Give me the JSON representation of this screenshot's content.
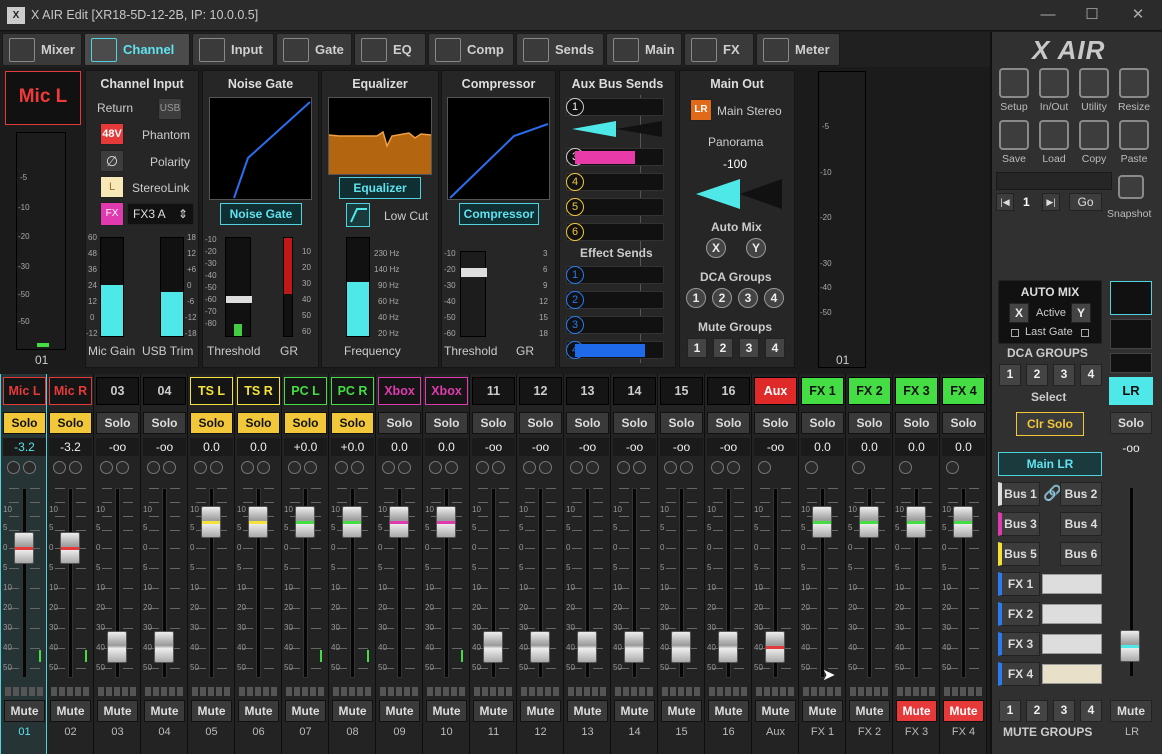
{
  "window": {
    "title": "X AIR Edit [XR18-5D-12-2B, IP: 10.0.0.5]",
    "app_icon": "X",
    "min": "—",
    "max": "☐",
    "close": "✕"
  },
  "tabs": [
    {
      "label": "Mixer"
    },
    {
      "label": "Channel"
    },
    {
      "label": "Input"
    },
    {
      "label": "Gate"
    },
    {
      "label": "EQ"
    },
    {
      "label": "Comp"
    },
    {
      "label": "Sends"
    },
    {
      "label": "Main"
    },
    {
      "label": "FX"
    },
    {
      "label": "Meter"
    }
  ],
  "channel": {
    "name": "Mic L",
    "meter_number": "01",
    "meter_scale": [
      "-5",
      "-10",
      "-20",
      "-30",
      "-50",
      "-50"
    ],
    "input": {
      "title": "Channel Input",
      "return": "Return",
      "usb": "USB",
      "btn_48v": "48V",
      "phantom": "Phantom",
      "polarity": "Polarity",
      "stereolink_btn": "L",
      "stereolink": "StereoLink",
      "fx_btn": "FX",
      "fx_select": "FX3 A",
      "mic_gain": "Mic Gain",
      "usb_trim": "USB Trim",
      "gain_scale": [
        "60",
        "48",
        "36",
        "24",
        "12",
        "0",
        "-12"
      ],
      "trim_scale": [
        "18",
        "12",
        "+6",
        "0",
        "-6",
        "-12",
        "-18"
      ],
      "mic_gain_level": 0.52,
      "usb_trim_level": 0.45
    },
    "gate": {
      "title": "Noise Gate",
      "button": "Noise Gate",
      "threshold": "Threshold",
      "gr": "GR",
      "thr_scale": [
        "-10",
        "-20",
        "-30",
        "-40",
        "-50",
        "-60",
        "-70",
        "-80"
      ],
      "gr_scale": [
        "10",
        "20",
        "30",
        "40",
        "50",
        "60"
      ]
    },
    "eq": {
      "title": "Equalizer",
      "button": "Equalizer",
      "lowcut": "Low Cut",
      "frequency": "Frequency",
      "freq_scale": [
        "230 Hz",
        "140 Hz",
        "90 Hz",
        "60 Hz",
        "40 Hz",
        "20 Hz"
      ],
      "freq_level": 0.55
    },
    "comp": {
      "title": "Compressor",
      "button": "Compressor",
      "threshold": "Threshold",
      "gr": "GR",
      "thr_scale": [
        "-10",
        "-20",
        "-30",
        "-40",
        "-50",
        "-60"
      ],
      "gr_scale": [
        "3",
        "6",
        "9",
        "12",
        "15",
        "18"
      ]
    },
    "aux": {
      "title": "Aux Bus Sends",
      "sends": [
        {
          "n": "1",
          "level": 0,
          "color": "#4fe8e8"
        },
        {
          "n": "3",
          "level": 0.68,
          "color": "#e83aa8"
        },
        {
          "n": "4",
          "level": 0,
          "color": "#f2c73a"
        },
        {
          "n": "5",
          "level": 0,
          "color": "#f2c73a"
        },
        {
          "n": "6",
          "level": 0,
          "color": "#f2c73a"
        }
      ],
      "effect_title": "Effect Sends",
      "effects": [
        {
          "n": "1",
          "level": 0,
          "color": "#1e6ae8"
        },
        {
          "n": "2",
          "level": 0,
          "color": "#1e6ae8"
        },
        {
          "n": "3",
          "level": 0,
          "color": "#1e6ae8"
        },
        {
          "n": "4",
          "level": 0.8,
          "color": "#1e6ae8"
        }
      ]
    },
    "main": {
      "title": "Main Out",
      "lr": "LR",
      "main_stereo": "Main Stereo",
      "panorama": "Panorama",
      "pan_value": "-100",
      "automix": "Auto Mix",
      "x": "X",
      "y": "Y",
      "dca": "DCA Groups",
      "dca_btns": [
        "1",
        "2",
        "3",
        "4"
      ],
      "mute_groups": "Mute Groups",
      "mute_btns": [
        "1",
        "2",
        "3",
        "4"
      ]
    },
    "right_meter_number": "01",
    "right_meter_scale": [
      "-5",
      "-10",
      "-20",
      "-30",
      "-40",
      "-50"
    ]
  },
  "strips": [
    {
      "name": "Mic L",
      "value": "-3.2",
      "solo": true,
      "mute": false,
      "num": "01",
      "color": "#e63a3a",
      "nameColor": "#e63a3a",
      "nameBg": "#151515",
      "fader": 0.21,
      "line": "#e63a3a",
      "dots": 2,
      "mini": true
    },
    {
      "name": "Mic R",
      "value": "-3.2",
      "solo": true,
      "mute": false,
      "num": "02",
      "color": "#e63a3a",
      "nameColor": "#e63a3a",
      "nameBg": "#151515",
      "fader": 0.21,
      "line": "#e63a3a",
      "dots": 2,
      "mini": true
    },
    {
      "name": "03",
      "value": "-oo",
      "solo": false,
      "mute": false,
      "num": "03",
      "nameColor": "#ccc",
      "nameBg": "#151515",
      "fader": 0.87,
      "line": "",
      "dots": 2
    },
    {
      "name": "04",
      "value": "-oo",
      "solo": false,
      "mute": false,
      "num": "04",
      "nameColor": "#ccc",
      "nameBg": "#151515",
      "fader": 0.87,
      "line": "",
      "dots": 2
    },
    {
      "name": "TS L",
      "value": "0.0",
      "solo": true,
      "mute": false,
      "num": "05",
      "nameColor": "#f2e23a",
      "nameBg": "#151515",
      "fader": 0.04,
      "line": "#f2e23a",
      "dots": 2
    },
    {
      "name": "TS R",
      "value": "0.0",
      "solo": true,
      "mute": false,
      "num": "06",
      "nameColor": "#f2e23a",
      "nameBg": "#151515",
      "fader": 0.04,
      "line": "#f2e23a",
      "dots": 2
    },
    {
      "name": "PC L",
      "value": "+0.0",
      "solo": true,
      "mute": false,
      "num": "07",
      "nameColor": "#44dd44",
      "nameBg": "#151515",
      "fader": 0.04,
      "line": "#44dd44",
      "dots": 2,
      "mini": true
    },
    {
      "name": "PC R",
      "value": "+0.0",
      "solo": true,
      "mute": false,
      "num": "08",
      "nameColor": "#44dd44",
      "nameBg": "#151515",
      "fader": 0.04,
      "line": "#44dd44",
      "dots": 2,
      "mini": true
    },
    {
      "name": "Xbox L",
      "value": "0.0",
      "solo": false,
      "mute": false,
      "num": "09",
      "nameColor": "#e03ab0",
      "nameBg": "#151515",
      "fader": 0.04,
      "line": "#e03ab0",
      "dots": 2
    },
    {
      "name": "Xbox R",
      "value": "0.0",
      "solo": false,
      "mute": false,
      "num": "10",
      "nameColor": "#e03ab0",
      "nameBg": "#151515",
      "fader": 0.04,
      "line": "#e03ab0",
      "dots": 2,
      "mini": true
    },
    {
      "name": "11",
      "value": "-oo",
      "solo": false,
      "mute": false,
      "num": "11",
      "nameColor": "#ccc",
      "nameBg": "#151515",
      "fader": 0.87,
      "line": "",
      "dots": 2
    },
    {
      "name": "12",
      "value": "-oo",
      "solo": false,
      "mute": false,
      "num": "12",
      "nameColor": "#ccc",
      "nameBg": "#151515",
      "fader": 0.87,
      "line": "",
      "dots": 2
    },
    {
      "name": "13",
      "value": "-oo",
      "solo": false,
      "mute": false,
      "num": "13",
      "nameColor": "#ccc",
      "nameBg": "#151515",
      "fader": 0.87,
      "line": "",
      "dots": 2
    },
    {
      "name": "14",
      "value": "-oo",
      "solo": false,
      "mute": false,
      "num": "14",
      "nameColor": "#ccc",
      "nameBg": "#151515",
      "fader": 0.87,
      "line": "",
      "dots": 2
    },
    {
      "name": "15",
      "value": "-oo",
      "solo": false,
      "mute": false,
      "num": "15",
      "nameColor": "#ccc",
      "nameBg": "#151515",
      "fader": 0.87,
      "line": "",
      "dots": 2
    },
    {
      "name": "16",
      "value": "-oo",
      "solo": false,
      "mute": false,
      "num": "16",
      "nameColor": "#ccc",
      "nameBg": "#151515",
      "fader": 0.87,
      "line": "",
      "dots": 2
    },
    {
      "name": "Aux",
      "value": "-oo",
      "solo": false,
      "mute": false,
      "num": "Aux",
      "nameColor": "#ffffff",
      "nameBg": "#e02a2a",
      "fader": 0.87,
      "line": "#e63a3a",
      "dots": 1
    },
    {
      "name": "FX 1",
      "value": "0.0",
      "solo": false,
      "mute": false,
      "num": "FX 1",
      "nameColor": "#111",
      "nameBg": "#44dd44",
      "fader": 0.04,
      "line": "#44dd44",
      "dots": 1
    },
    {
      "name": "FX 2",
      "value": "0.0",
      "solo": false,
      "mute": false,
      "num": "FX 2",
      "nameColor": "#111",
      "nameBg": "#44dd44",
      "fader": 0.04,
      "line": "#44dd44",
      "dots": 1
    },
    {
      "name": "FX 3",
      "value": "0.0",
      "solo": false,
      "mute": true,
      "num": "FX 3",
      "nameColor": "#111",
      "nameBg": "#44dd44",
      "fader": 0.04,
      "line": "#44dd44",
      "dots": 1
    },
    {
      "name": "FX 4",
      "value": "0.0",
      "solo": false,
      "mute": true,
      "num": "FX 4",
      "nameColor": "#111",
      "nameBg": "#44dd44",
      "fader": 0.04,
      "line": "#44dd44",
      "dots": 1
    }
  ],
  "fader_scale": [
    "10",
    "5",
    "0",
    "5",
    "10",
    "20",
    "30",
    "40",
    "50"
  ],
  "right": {
    "logo": "X AIR",
    "tools": [
      "Setup",
      "In/Out",
      "Utility",
      "Resize",
      "Save",
      "Load",
      "Copy",
      "Paste"
    ],
    "snapshot_num": "1",
    "go": "Go",
    "snapshot": "Snapshot",
    "automix_title": "AUTO MIX",
    "x": "X",
    "active": "Active",
    "y": "Y",
    "last_gate": "Last Gate",
    "dca_title": "DCA GROUPS",
    "dca": [
      "1",
      "2",
      "3",
      "4"
    ],
    "select": "Select",
    "clr_solo": "Clr Solo",
    "main_lr": "Main LR",
    "buses": [
      "Bus 1",
      "Bus 2",
      "Bus 3",
      "Bus 4",
      "Bus 5",
      "Bus 6"
    ],
    "fx": [
      "FX 1",
      "FX 2",
      "FX 3",
      "FX 4"
    ],
    "mute_groups": [
      "1",
      "2",
      "3",
      "4"
    ],
    "mute_groups_title": "MUTE GROUPS",
    "lr": {
      "name": "LR",
      "solo": "Solo",
      "value": "-oo",
      "mute": "Mute",
      "num": "LR",
      "fader": 0.87
    }
  },
  "labels": {
    "solo": "Solo",
    "mute": "Mute"
  }
}
